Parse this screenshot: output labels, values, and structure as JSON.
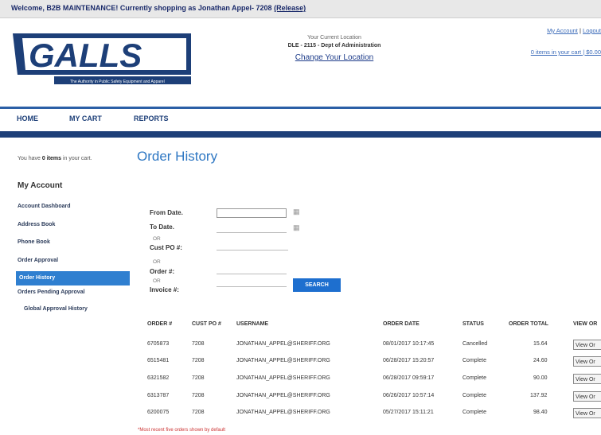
{
  "topbar": {
    "welcome_text": "Welcome, B2B MAINTENANCE! Currently shopping as Jonathan Appel- 7208",
    "release_link": "(Release)"
  },
  "brand": {
    "logo_text": "GALLS",
    "tagline": "The Authority in Public Safety Equipment and Apparel"
  },
  "location": {
    "label": "Your Current Location",
    "value": "DLE - 2115 - Dept of Administration",
    "change_link": "Change Your Location"
  },
  "account_links": {
    "my_account": "My Account",
    "separator": "|",
    "logout": "Logout",
    "cart": "0 items in your cart | $0.00"
  },
  "nav": {
    "home": "HOME",
    "cart": "MY CART",
    "reports": "REPORTS"
  },
  "cart_msg": {
    "pre": "You have",
    "count": "0 items",
    "post": "in your cart."
  },
  "page_title": "Order History",
  "sidebar": {
    "title": "My Account",
    "items": [
      {
        "label": "Account Dashboard"
      },
      {
        "label": "Address Book"
      },
      {
        "label": "Phone Book"
      },
      {
        "label": "Order Approval"
      },
      {
        "label": "Order History"
      },
      {
        "label": "Orders Pending Approval"
      },
      {
        "label": "Global Approval History"
      }
    ]
  },
  "form": {
    "from_date": "From Date.",
    "to_date": "To Date.",
    "or1": "OR",
    "cust_po": "Cust PO #:",
    "or2": "OR",
    "order": "Order #:",
    "or3": "OR",
    "invoice": "Invoice #:",
    "search_btn": "SEARCH"
  },
  "table": {
    "headers": [
      "ORDER #",
      "CUST PO #",
      "USERNAME",
      "ORDER DATE",
      "STATUS",
      "ORDER TOTAL",
      "VIEW OR"
    ],
    "rows": [
      {
        "order": "6705873",
        "po": "7208",
        "user": "JONATHAN_APPEL@SHERIFF.ORG",
        "date": "08/01/2017 10:17:45",
        "status": "Cancelled",
        "total": "15.64",
        "view": "View Or"
      },
      {
        "order": "6515481",
        "po": "7208",
        "user": "JONATHAN_APPEL@SHERIFF.ORG",
        "date": "06/28/2017 15:20:57",
        "status": "Complete",
        "total": "24.60",
        "view": "View Or"
      },
      {
        "order": "6321582",
        "po": "7208",
        "user": "JONATHAN_APPEL@SHERIFF.ORG",
        "date": "06/28/2017 09:59:17",
        "status": "Complete",
        "total": "90.00",
        "view": "View Or"
      },
      {
        "order": "6313787",
        "po": "7208",
        "user": "JONATHAN_APPEL@SHERIFF.ORG",
        "date": "06/26/2017 10:57:14",
        "status": "Complete",
        "total": "137.92",
        "view": "View Or"
      },
      {
        "order": "6200075",
        "po": "7208",
        "user": "JONATHAN_APPEL@SHERIFF.ORG",
        "date": "05/27/2017 15:11:21",
        "status": "Complete",
        "total": "98.40",
        "view": "View Or"
      }
    ]
  },
  "note": "*Most recent five orders shown by default",
  "colors": {
    "brand_blue": "#1d3f78",
    "accent_blue": "#2e77c3",
    "active_item": "#2f7fd0",
    "note_red": "#cc3333"
  },
  "icons": {
    "calendar": "calendar-icon"
  }
}
